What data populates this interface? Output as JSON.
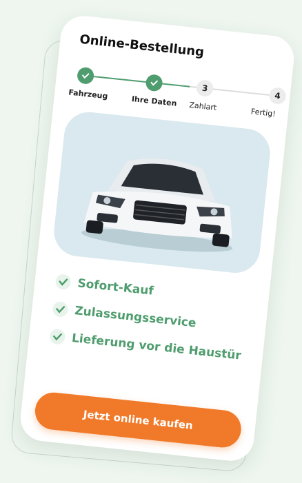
{
  "order": {
    "title": "Online-Bestellung",
    "steps": [
      {
        "number": "1",
        "label": "Fahrzeug",
        "status": "done"
      },
      {
        "number": "2",
        "label": "Ihre Daten",
        "status": "done"
      },
      {
        "number": "3",
        "label": "Zahlart",
        "status": "todo"
      },
      {
        "number": "4",
        "label": "Fertig!",
        "status": "todo"
      }
    ],
    "features": [
      "Sofort-Kauf",
      "Zulassungsservice",
      "Lieferung vor die Haustür"
    ],
    "cta_label": "Jetzt online kaufen"
  },
  "colors": {
    "accent_green": "#4f9d6e",
    "cta_orange": "#f07a2a",
    "image_bg": "#d9e9ef"
  }
}
